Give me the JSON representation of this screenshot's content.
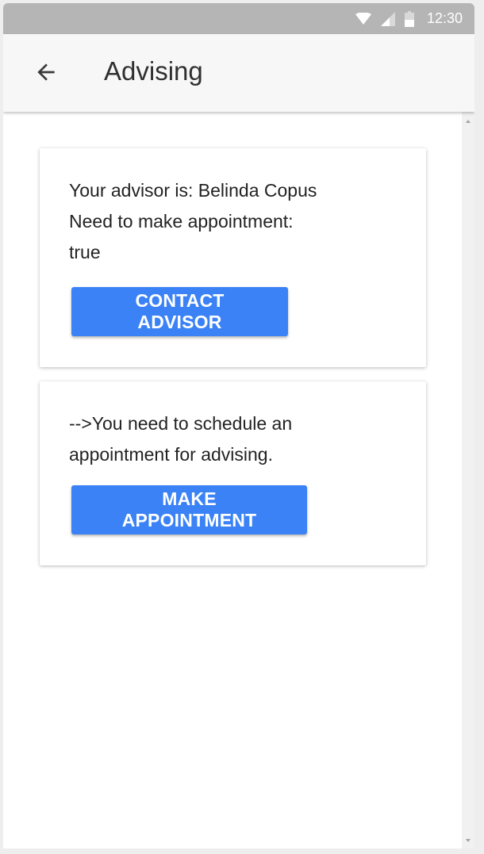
{
  "status_bar": {
    "time": "12:30",
    "icons": [
      "wifi-icon",
      "signal-icon",
      "battery-icon"
    ]
  },
  "app_bar": {
    "title": "Advising",
    "back_icon": "arrow-back-icon"
  },
  "advisor_card": {
    "advisor_line": "Your advisor is: Belinda Copus",
    "appointment_label": "Need to make appointment:",
    "appointment_value": "true",
    "button_label": "CONTACT ADVISOR"
  },
  "appointment_card": {
    "message_line_1": "-->You need to schedule an",
    "message_line_2": "appointment for advising.",
    "button_label": "MAKE APPOINTMENT"
  },
  "colors": {
    "status_bar": "#b5b5b6",
    "app_bar": "#f7f7f7",
    "button": "#3b82f6",
    "text": "#222222"
  }
}
